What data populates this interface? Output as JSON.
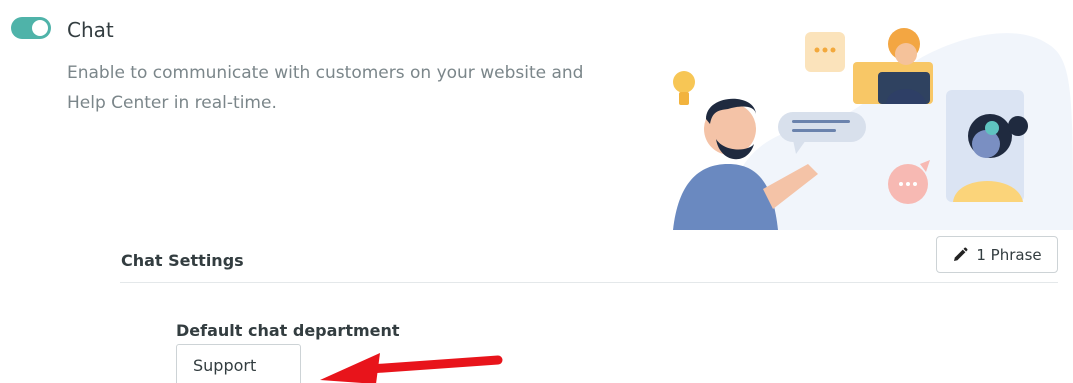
{
  "header": {
    "toggle_state": "on",
    "title": "Chat",
    "description": "Enable to communicate with customers on your website and Help Center in real-time."
  },
  "illustration": {
    "icon": "chat-support-illustration"
  },
  "settings": {
    "section_title": "Chat Settings",
    "phrase_button_label": "1 Phrase",
    "phrase_button_icon": "pencil-icon",
    "default_department_label": "Default chat department",
    "default_department_value": "Support"
  },
  "colors": {
    "toggle_on": "#4fb3a9",
    "annotation_arrow": "#e8141b"
  }
}
